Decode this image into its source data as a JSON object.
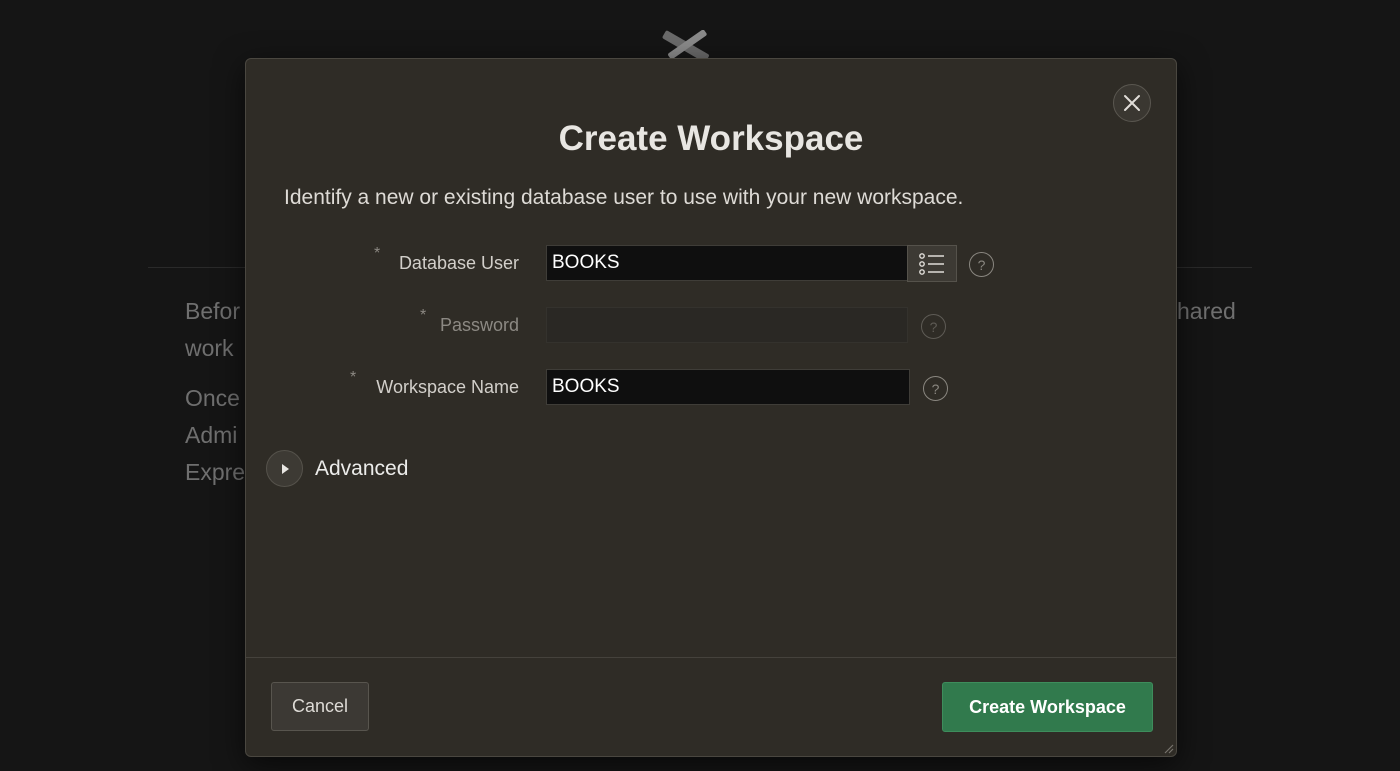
{
  "background": {
    "lines": [
      "Befor",
      "work",
      "Once",
      "Admi",
      "Expre",
      "hared"
    ]
  },
  "dialog": {
    "title": "Create Workspace",
    "intro": "Identify a new or existing database user to use with your new workspace.",
    "required_mark": "*",
    "fields": {
      "database_user": {
        "label": "Database User",
        "value": "BOOKS"
      },
      "password": {
        "label": "Password",
        "value": ""
      },
      "workspace_name": {
        "label": "Workspace Name",
        "value": "BOOKS"
      }
    },
    "help_glyph": "?",
    "advanced_label": "Advanced",
    "cancel_label": "Cancel",
    "create_label": "Create Workspace"
  },
  "colors": {
    "primary_button": "#317a4d",
    "dialog_bg": "#2f2c26",
    "page_bg": "#151515"
  },
  "icons": [
    "close-icon",
    "list-icon",
    "help-icon",
    "play-triangle-icon",
    "resize-grip-icon"
  ]
}
